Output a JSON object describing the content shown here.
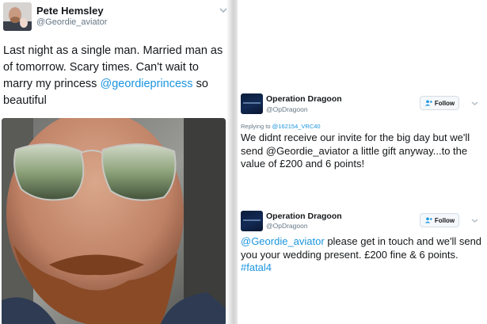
{
  "left_tweet": {
    "author_name": "Pete Hemsley",
    "author_handle": "@Geordie_aviator",
    "text_part1": "Last night as a single man. Married man as of tomorrow. Scary times. Can't wait to marry my princess ",
    "text_mention": "@geordieprincess",
    "text_part2": " so beautiful",
    "caret_icon": "chevron-down-icon",
    "photo_icon": "selfie-photo"
  },
  "reply_tweet_1": {
    "author_name": "Operation Dragoon",
    "author_handle": "@OpDragoon",
    "follow_label": "Follow",
    "replying_prefix": "Replying to ",
    "replying_to": "@162154_VRC40",
    "text": "We didnt receive our invite for the big day but we'll send @Geordie_aviator a little gift anyway...to the value of £200 and 6 points!"
  },
  "reply_tweet_2": {
    "author_name": "Operation Dragoon",
    "author_handle": "@OpDragoon",
    "follow_label": "Follow",
    "text_mention": "@Geordie_aviator",
    "text_part": " please get in touch and we'll send you your wedding present. £200 fine & 6 points.",
    "hashtag": "#fatal4"
  },
  "colors": {
    "link": "#1b95e0",
    "text": "#14171a",
    "secondary": "#657786",
    "avatar_navy": "#122a55"
  }
}
